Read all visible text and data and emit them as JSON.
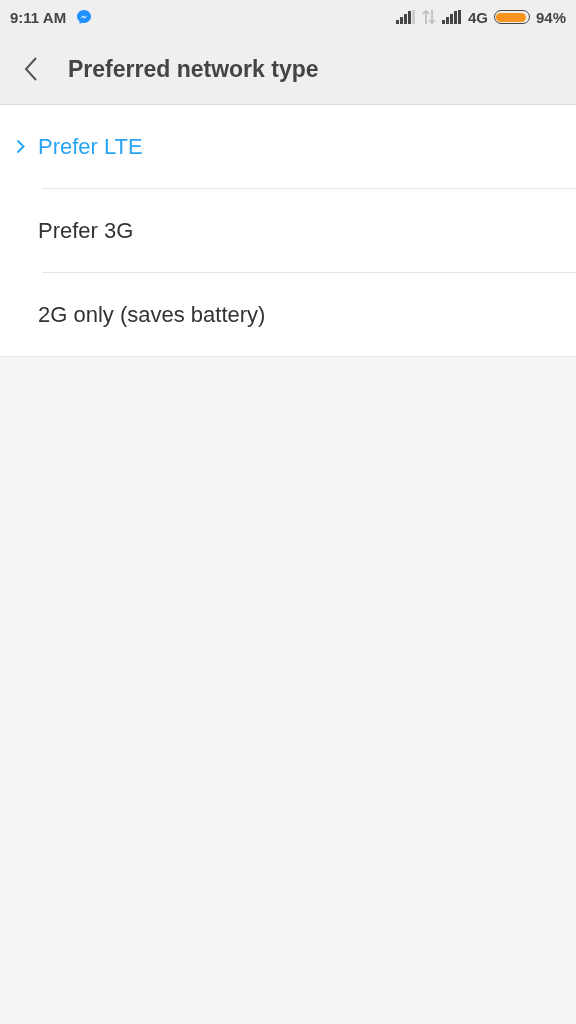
{
  "status_bar": {
    "time": "9:11 AM",
    "network": "4G",
    "battery": {
      "level": 0.94
    },
    "battery_percent": "94%"
  },
  "header": {
    "title": "Preferred network type"
  },
  "options": [
    {
      "label": "Prefer LTE",
      "selected": true
    },
    {
      "label": "Prefer 3G",
      "selected": false
    },
    {
      "label": "2G only (saves battery)",
      "selected": false
    }
  ]
}
